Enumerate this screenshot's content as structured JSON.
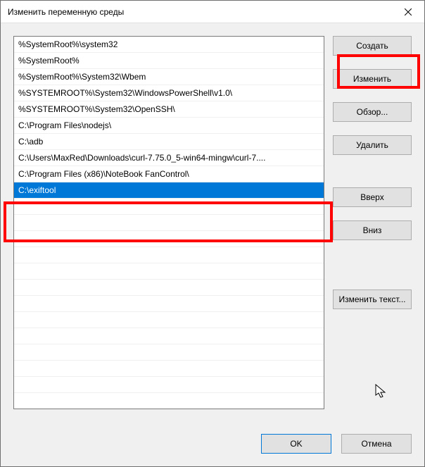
{
  "window": {
    "title": "Изменить переменную среды"
  },
  "list": {
    "items": [
      "%SystemRoot%\\system32",
      "%SystemRoot%",
      "%SystemRoot%\\System32\\Wbem",
      "%SYSTEMROOT%\\System32\\WindowsPowerShell\\v1.0\\",
      "%SYSTEMROOT%\\System32\\OpenSSH\\",
      "C:\\Program Files\\nodejs\\",
      "C:\\adb",
      "C:\\Users\\MaxRed\\Downloads\\curl-7.75.0_5-win64-mingw\\curl-7....",
      "C:\\Program Files (x86)\\NoteBook FanControl\\",
      "C:\\exiftool"
    ],
    "selectedIndex": 9
  },
  "buttons": {
    "create": "Создать",
    "edit": "Изменить",
    "browse": "Обзор...",
    "delete": "Удалить",
    "up": "Вверх",
    "down": "Вниз",
    "editText": "Изменить текст..."
  },
  "bottomButtons": {
    "ok": "OK",
    "cancel": "Отмена"
  }
}
